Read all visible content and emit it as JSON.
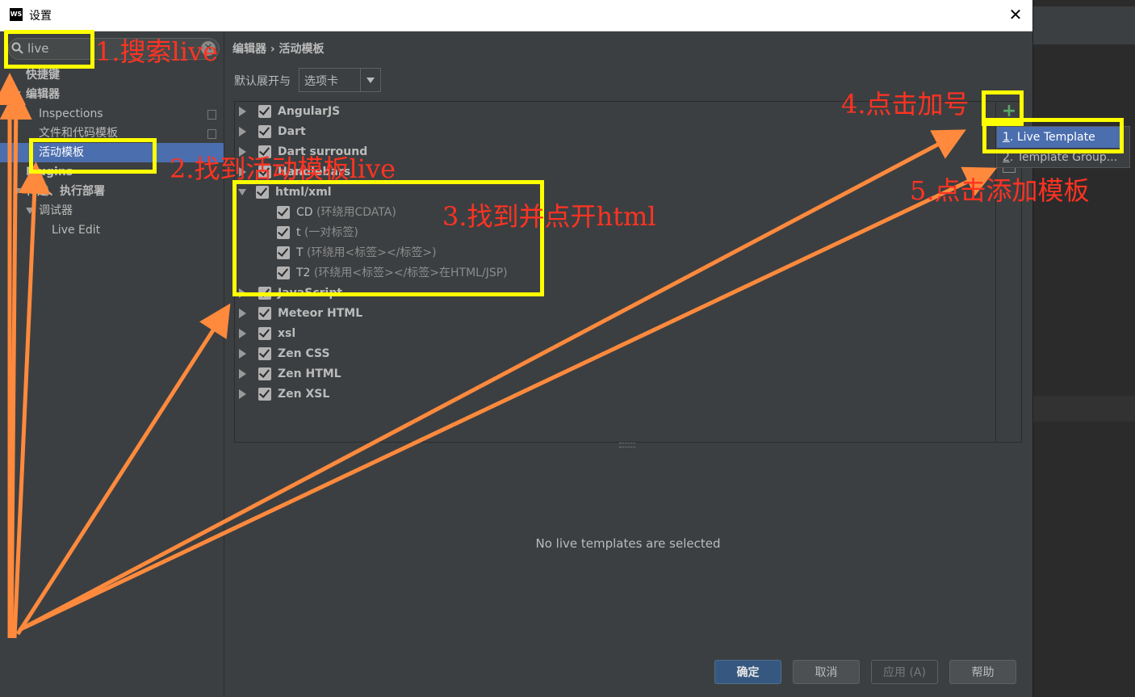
{
  "dialog": {
    "app_icon_text": "WS",
    "title": "设置",
    "close": "✕"
  },
  "search": {
    "value": "live",
    "clear": "✕"
  },
  "left_tree": [
    {
      "label": "快捷键"
    },
    {
      "label": "编辑器"
    },
    {
      "label": "Inspections"
    },
    {
      "label": "文件和代码模板"
    },
    {
      "label": "活动模板"
    },
    {
      "label": "Plugins"
    },
    {
      "label": "构建、执行部署"
    },
    {
      "label": "调试器"
    },
    {
      "label": "Live Edit"
    }
  ],
  "breadcrumb": "编辑器 › 活动模板",
  "expand": {
    "label": "默认展开与",
    "value": "选项卡"
  },
  "templates": [
    {
      "label": "AngularJS",
      "expanded": false,
      "checked": true
    },
    {
      "label": "Dart",
      "expanded": false,
      "checked": true
    },
    {
      "label": "Dart surround",
      "expanded": false,
      "checked": true
    },
    {
      "label": "Handlebars",
      "expanded": false,
      "checked": true
    },
    {
      "label": "html/xml",
      "expanded": true,
      "checked": true,
      "children": [
        {
          "abbr": "CD",
          "desc": "(环绕用CDATA)"
        },
        {
          "abbr": "t",
          "desc": "(一对标签)"
        },
        {
          "abbr": "T",
          "desc": "(环绕用<标签></标签>)"
        },
        {
          "abbr": "T2",
          "desc": "(环绕用<标签></标签>在HTML/JSP)"
        }
      ]
    },
    {
      "label": "JavaScript",
      "expanded": false,
      "checked": true
    },
    {
      "label": "Meteor HTML",
      "expanded": false,
      "checked": true
    },
    {
      "label": "xsl",
      "expanded": false,
      "checked": true
    },
    {
      "label": "Zen CSS",
      "expanded": false,
      "checked": true
    },
    {
      "label": "Zen HTML",
      "expanded": false,
      "checked": true
    },
    {
      "label": "Zen XSL",
      "expanded": false,
      "checked": true
    }
  ],
  "toolbar": {
    "plus": "+"
  },
  "popup": {
    "item1_num": "1",
    "item1_label": ". Live Template",
    "item2_num": "2",
    "item2_label": ". Template Group..."
  },
  "empty_message": "No live templates are selected",
  "buttons": {
    "ok": "确定",
    "cancel": "取消",
    "apply": "应用 (A)",
    "help": "帮助"
  },
  "annotations": {
    "step1": "1.搜索live",
    "step2": "2.找到活动模板live",
    "step3": "3.找到并点开html",
    "step4": "4.点击加号",
    "step5": "5.点击添加模板"
  },
  "colors": {
    "accent": "#4b6eaf",
    "highlight": "#ffff00",
    "note": "#ff3322",
    "arrow": "#ff8a3d"
  }
}
